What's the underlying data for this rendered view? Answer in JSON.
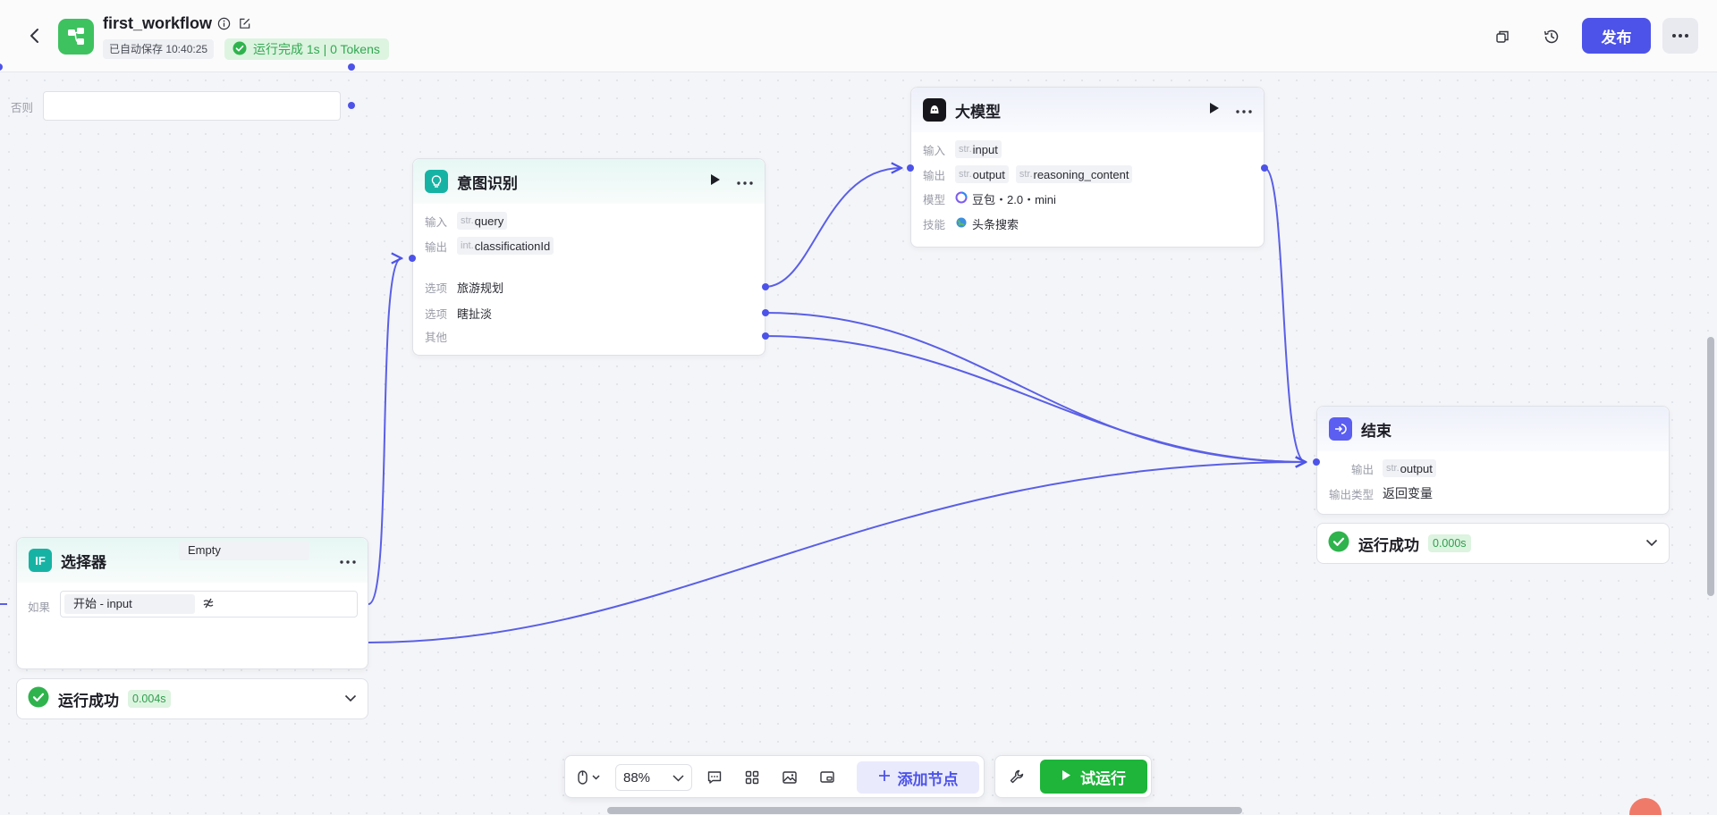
{
  "header": {
    "title": "first_workflow",
    "autosave": "已自动保存 10:40:25",
    "run_status": "运行完成 1s | 0 Tokens",
    "publish_label": "发布"
  },
  "nodes": {
    "intent": {
      "title": "意图识别",
      "input_label": "输入",
      "input": {
        "type": "str.",
        "name": "query"
      },
      "output_label": "输出",
      "output": {
        "type": "int.",
        "name": "classificationId"
      },
      "option_label": "选项",
      "options": [
        "旅游规划",
        "瞎扯淡"
      ],
      "other_label": "其他"
    },
    "llm": {
      "title": "大模型",
      "input_label": "输入",
      "input": {
        "type": "str.",
        "name": "input"
      },
      "output_label": "输出",
      "outputs": [
        {
          "type": "str.",
          "name": "output"
        },
        {
          "type": "str.",
          "name": "reasoning_content"
        }
      ],
      "model_label": "模型",
      "model": "豆包・2.0・mini",
      "skill_label": "技能",
      "skill": "头条搜索"
    },
    "selector": {
      "title": "选择器",
      "icon_text": "IF",
      "if_label": "如果",
      "cond_left": "开始  -  input",
      "cond_right": "Empty",
      "else_label": "否则",
      "status": "运行成功",
      "time": "0.004s"
    },
    "end": {
      "title": "结束",
      "output_label": "输出",
      "output": {
        "type": "str.",
        "name": "output"
      },
      "output_type_label": "输出类型",
      "output_type": "返回变量",
      "status": "运行成功",
      "time": "0.000s"
    }
  },
  "toolbar": {
    "zoom": "88%",
    "add_node": "添加节点",
    "trial_run": "试运行"
  },
  "colors": {
    "accent": "#4d53e8",
    "success": "#1eb53a",
    "logo": "#3ec25f",
    "intent_icon": "#16b3a4",
    "selector_icon": "#16b3a4",
    "end_icon": "#5b5ef0"
  }
}
